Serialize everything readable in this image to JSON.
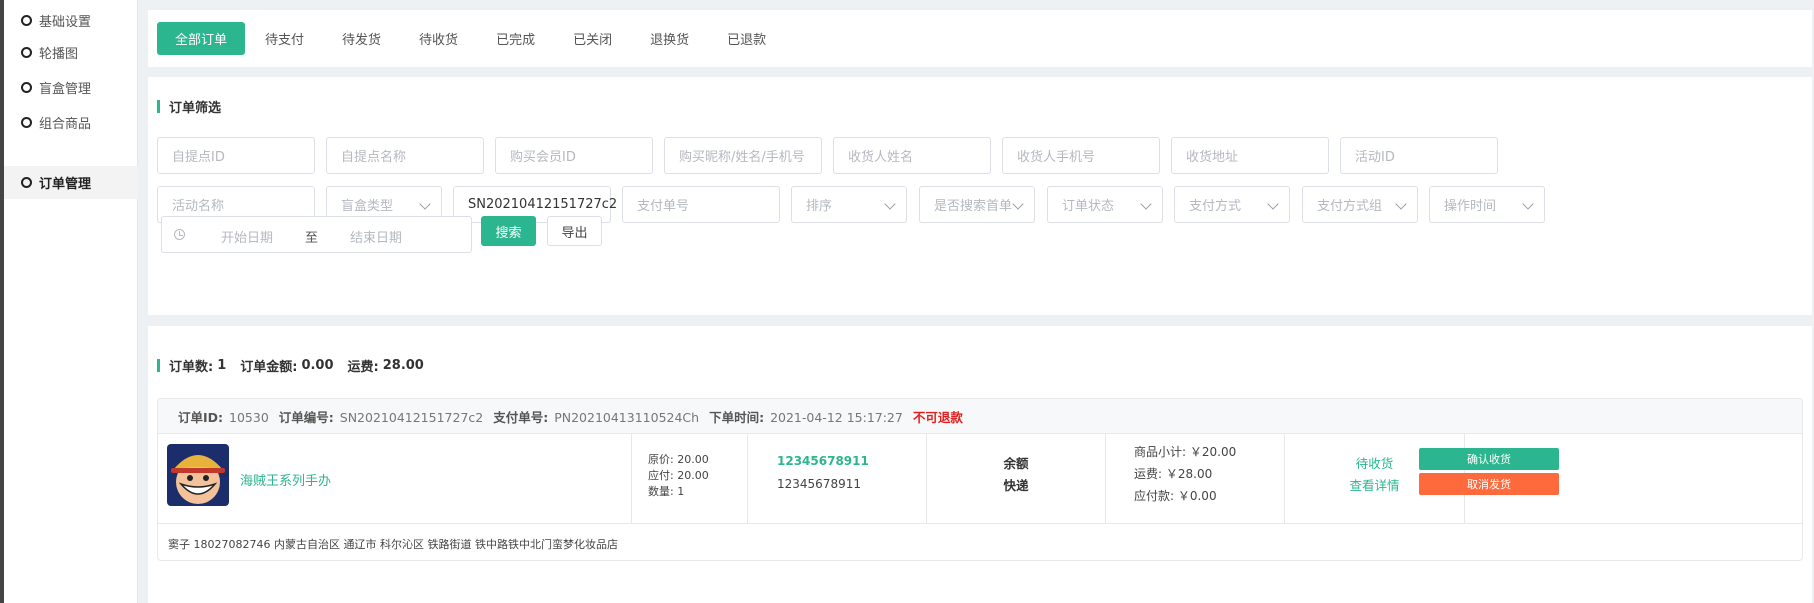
{
  "sidebar": {
    "items": [
      {
        "label": "基础设置",
        "active": false
      },
      {
        "label": "轮播图",
        "active": false
      },
      {
        "label": "盲盒管理",
        "active": false
      },
      {
        "label": "组合商品",
        "active": false
      },
      {
        "label": "订单管理",
        "active": true
      }
    ]
  },
  "tabs": [
    "全部订单",
    "待支付",
    "待发货",
    "待收货",
    "已完成",
    "已关闭",
    "退换货",
    "已退款"
  ],
  "active_tab": "全部订单",
  "filter": {
    "title": "订单筛选",
    "row1": [
      "自提点ID",
      "自提点名称",
      "购买会员ID",
      "购买昵称/姓名/手机号",
      "收货人姓名",
      "收货人手机号",
      "收货地址",
      "活动ID"
    ],
    "activity_name_placeholder": "活动名称",
    "blindbox_type_placeholder": "盲盒类型",
    "order_no_value": "SN20210412151727c2",
    "pay_no_placeholder": "支付单号",
    "selects": [
      "排序",
      "是否搜索首单",
      "订单状态",
      "支付方式",
      "支付方式组",
      "操作时间"
    ],
    "date_start_placeholder": "开始日期",
    "date_sep": "至",
    "date_end_placeholder": "结束日期",
    "search_label": "搜索",
    "export_label": "导出"
  },
  "summary": {
    "count_label": "订单数:",
    "count_value": "1",
    "amount_label": "订单金额:",
    "amount_value": "0.00",
    "freight_label": "运费:",
    "freight_value": "28.00"
  },
  "order": {
    "id_label": "订单ID:",
    "id": "10530",
    "no_label": "订单编号:",
    "no": "SN20210412151727c2",
    "pay_label": "支付单号:",
    "pay_no": "PN20210413110524Ch",
    "time_label": "下单时间:",
    "time": "2021-04-12 15:17:27",
    "refund_flag": "不可退款",
    "goods_name": "海贼王系列手办",
    "original_price": "原价: 20.00",
    "payable_price": "应付: 20.00",
    "quantity": "数量: 1",
    "phone_primary": "12345678911",
    "phone_secondary": "12345678911",
    "pay_method": "余额",
    "delivery": "快递",
    "subtotal": "商品小计: ￥20.00",
    "freight": "运费: ￥28.00",
    "payable": "应付款: ￥0.00",
    "status": "待收货",
    "detail_link": "查看详情",
    "confirm_label": "确认收货",
    "cancel_label": "取消发货",
    "address": "窦子  18027082746  内蒙古自治区 通辽市 科尔沁区 铁路街道 铁中路铁中北门蛮梦化妆品店"
  },
  "colors": {
    "accent": "#2bb68f",
    "danger": "#e02020",
    "cancel": "#ff6a3d"
  }
}
